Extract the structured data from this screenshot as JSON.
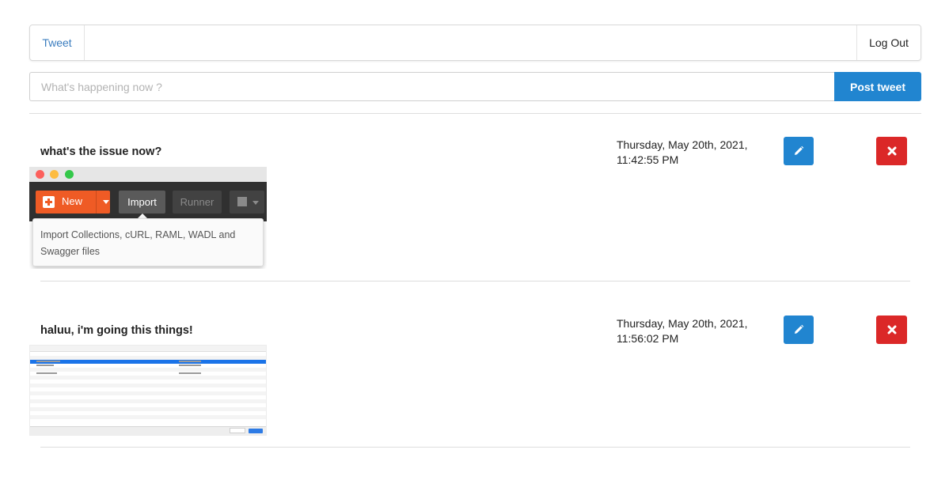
{
  "nav": {
    "brand": "Tweet",
    "logout": "Log Out"
  },
  "composer": {
    "placeholder": "What's happening now ?",
    "value": "",
    "post_label": "Post tweet"
  },
  "colors": {
    "primary": "#2185d0",
    "danger": "#db2828"
  },
  "tweets": [
    {
      "text": "what's the issue now?",
      "time_line1": "Thursday, May 20th, 2021,",
      "time_line2": "11:42:55 PM",
      "image": {
        "new_label": "New",
        "import_label": "Import",
        "runner_label": "Runner",
        "tooltip": "Import Collections, cURL, RAML, WADL and Swagger files"
      }
    },
    {
      "text": "haluu, i'm going this things!",
      "time_line1": "Thursday, May 20th, 2021,",
      "time_line2": "11:56:02 PM"
    }
  ],
  "icons": {
    "edit": "pencil-icon",
    "delete": "close-icon"
  }
}
